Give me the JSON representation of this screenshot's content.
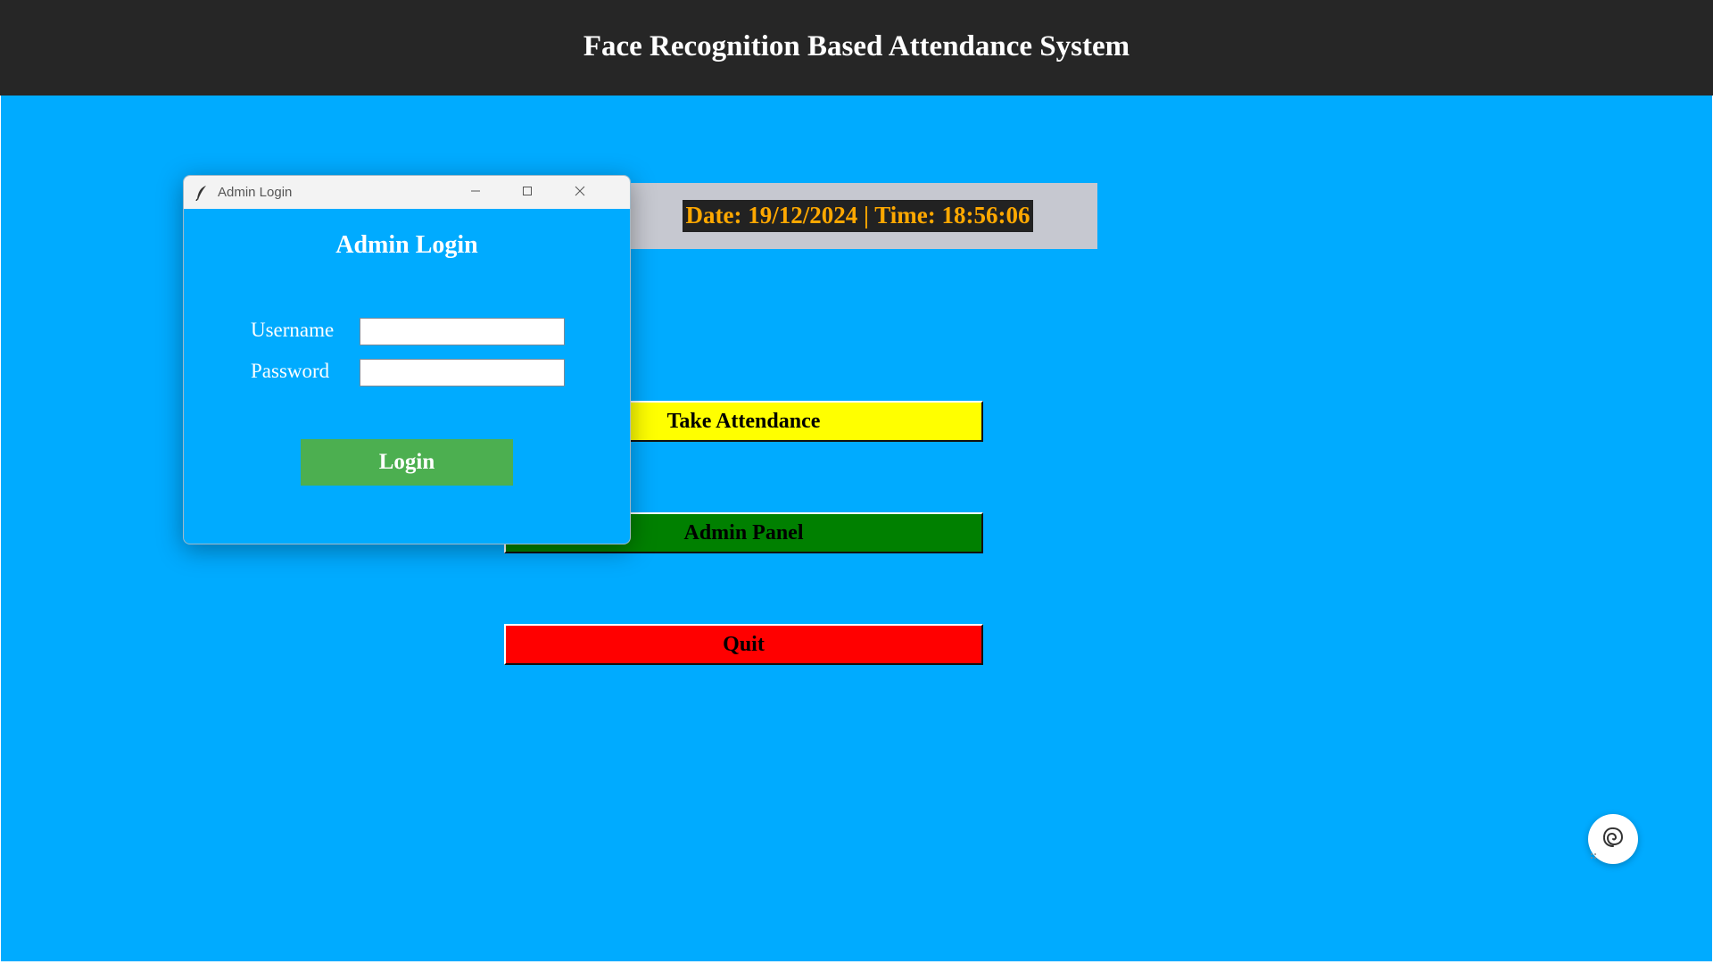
{
  "app": {
    "title": "Face Recognition Based Attendance System",
    "clock": "Date: 19/12/2024 | Time: 18:56:06"
  },
  "menu": {
    "take_attendance": "Take Attendance",
    "admin_panel": "Admin Panel",
    "quit": "Quit"
  },
  "dialog": {
    "window_title": "Admin Login",
    "heading": "Admin Login",
    "username_label": "Username",
    "password_label": "Password",
    "username_value": "",
    "password_value": "",
    "login_label": "Login"
  },
  "colors": {
    "background": "#00abff",
    "titlebar": "#262626",
    "take_attendance": "#ffff00",
    "admin_panel": "#008000",
    "quit": "#ff0000",
    "login_button": "#4caf50",
    "clock_text": "#ffa800"
  },
  "icons": {
    "dialog_app": "feather-icon",
    "minimize": "minimize-icon",
    "maximize": "maximize-icon",
    "close": "close-icon",
    "float_widget": "spiral-icon"
  }
}
